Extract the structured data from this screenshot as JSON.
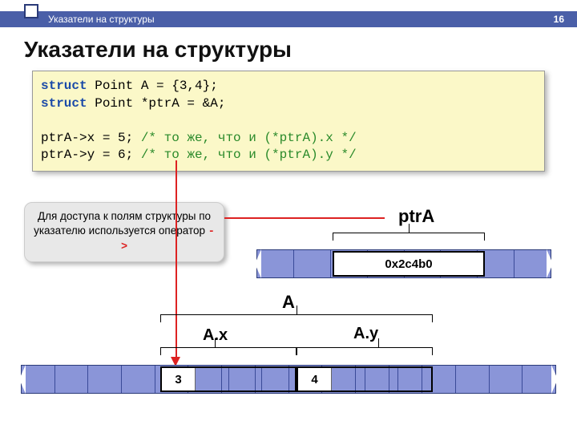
{
  "header": {
    "title": "Указатели на структуры",
    "page": "16"
  },
  "title": "Указатели на структуры",
  "code": {
    "kw_struct": "struct",
    "line1_rest": " Point A = {3,4};",
    "line2_rest": " Point *ptrA = &A;",
    "line4_left": "ptrA->x = 5; ",
    "line4_cm": "/* то же, что и (*ptrA).x */",
    "line5_left": "ptrA->y = 6; ",
    "line5_cm": "/* то же, что и (*ptrA).y */"
  },
  "callout": {
    "text_main": "Для доступа к полям структуры по указателю используется оператор ",
    "op": "->"
  },
  "labels": {
    "ptrA": "ptrA",
    "A": "A",
    "Ax": "A.x",
    "Ay": "A.y"
  },
  "memory": {
    "ptr_value": "0x2c4b0",
    "Ax_value": "3",
    "Ay_value": "4"
  }
}
